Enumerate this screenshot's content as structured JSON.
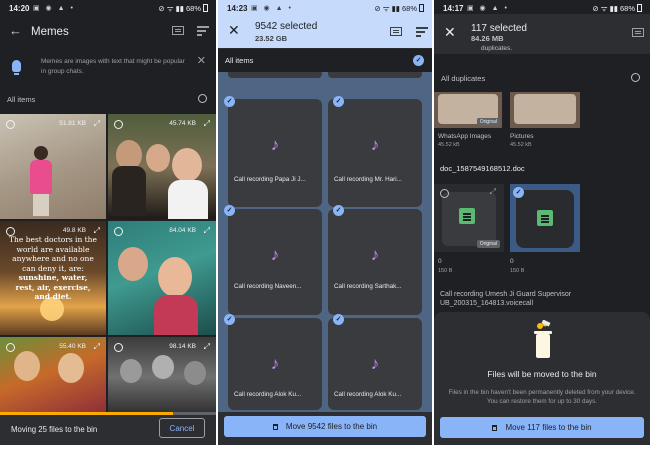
{
  "panels": [
    {
      "status": {
        "time": "14:20",
        "notif": "▣ ◉ ▲ •",
        "right": "⊘ ᯤ ▮▮ 68%"
      },
      "header": {
        "title": "Memes"
      },
      "tip": {
        "text": "Memes are images with text that might be popular in group chats."
      },
      "all_items_label": "All items",
      "thumbs": [
        {
          "size": "51.81 KB"
        },
        {
          "size": "45.74 KB"
        },
        {
          "size": "49.8 KB",
          "meme_lines": [
            "The best doctors in the world are available anywhere and no one can deny it, are:",
            "sunshine, water, rest, air, exercise, and diet."
          ]
        },
        {
          "size": "84.04 KB"
        },
        {
          "size": "55.40 KB"
        },
        {
          "size": "98.14 KB"
        }
      ],
      "snackbar": {
        "text": "Moving 25 files to the bin",
        "action": "Cancel",
        "progress": 0.8
      }
    },
    {
      "status": {
        "time": "14:23",
        "notif": "▣ ◉ ▲ •",
        "right": "⊘ ᯤ ▮▮ 68%"
      },
      "header": {
        "title": "9542 selected",
        "subtitle": "23.52 GB"
      },
      "all_items_label": "All items",
      "items": [
        {
          "name": "Call recording Papa Ji J..."
        },
        {
          "name": "Call recording Mr. Hari..."
        },
        {
          "name": "Call recording Naveen..."
        },
        {
          "name": "Call recording Sarthak..."
        },
        {
          "name": "Call recording Alok Ku..."
        },
        {
          "name": "Call recording Alok Ku..."
        }
      ],
      "action": "Move 9542 files to the bin"
    },
    {
      "status": {
        "time": "14:17",
        "notif": "▣ ◉ ▲ •",
        "right": "⊘ ᯤ ▮▮ 68%"
      },
      "header": {
        "title": "117 selected",
        "subtitle": "84.26 MB",
        "peek": "duplicates."
      },
      "section_label": "All duplicates",
      "groups": [
        {
          "name": "WhatsApp Images",
          "size": "45.52 kB",
          "badge": "Original"
        },
        {
          "name": "Pictures",
          "size": "45.52 kB"
        }
      ],
      "doc_name": "doc_1587549168512.doc",
      "docs": [
        {
          "name": "0",
          "size": "150 B",
          "badge": "Original"
        },
        {
          "name": "0",
          "size": "150 B"
        }
      ],
      "call_name": "Call recording Umesh Ji Guard Supervisor UB_200315_164813.voicecall",
      "sheet": {
        "title": "Files will be moved to the bin",
        "desc": "Files in the bin haven't been permanently deleted from your device. You can restore them for up to 30 days."
      },
      "action": "Move 117 files to the bin"
    }
  ],
  "colors": {
    "accent": "#8ab4f8",
    "progress": "#f9ab00",
    "selection": "#c6dafc",
    "note": "#c58af9"
  }
}
